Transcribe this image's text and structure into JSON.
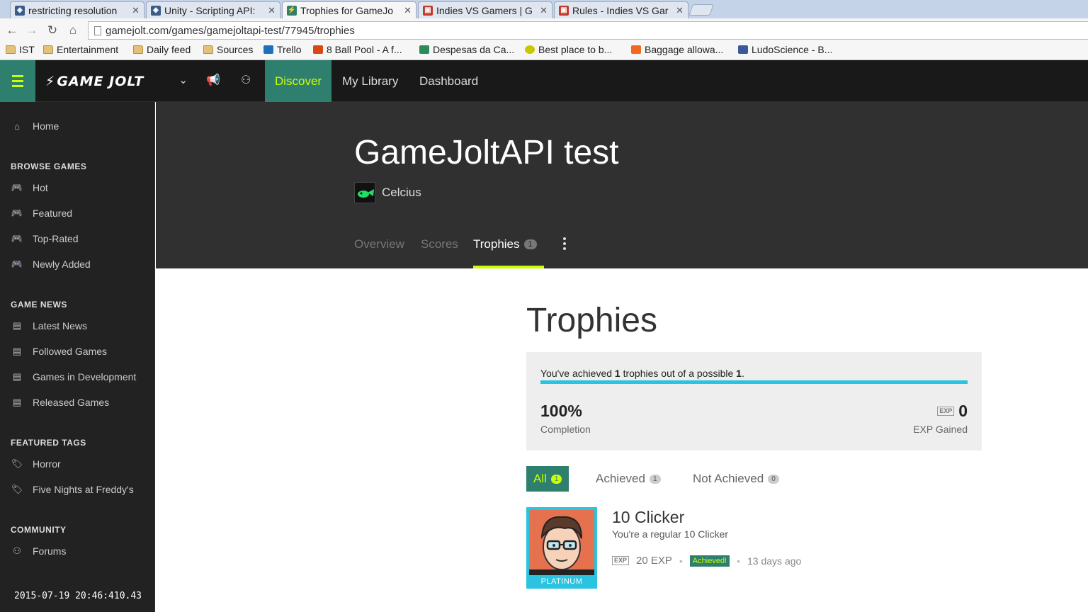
{
  "browser": {
    "tabs": [
      {
        "title": "restricting resolution",
        "icon_color": "#3b5b8a"
      },
      {
        "title": "Unity - Scripting API:",
        "icon_color": "#3b5b8a"
      },
      {
        "title": "Trophies for GameJo",
        "icon_color": "#2f7f6f"
      },
      {
        "title": "Indies VS Gamers | G",
        "icon_color": "#c0392b"
      },
      {
        "title": "Rules - Indies VS Gar",
        "icon_color": "#c0392b"
      }
    ],
    "url": "gamejolt.com/games/gamejoltapi-test/77945/trophies",
    "bookmarks": [
      {
        "label": "IST",
        "icon": "folder-icon"
      },
      {
        "label": "Entertainment",
        "icon": "folder-icon"
      },
      {
        "label": "Daily feed",
        "icon": "folder-icon"
      },
      {
        "label": "Sources",
        "icon": "folder-icon"
      },
      {
        "label": "Trello",
        "icon": "trello-icon"
      },
      {
        "label": "8 Ball Pool - A f...",
        "icon": "game-icon"
      },
      {
        "label": "Despesas da Ca...",
        "icon": "sheet-icon"
      },
      {
        "label": "Best place to b...",
        "icon": "smiley-icon"
      },
      {
        "label": "Baggage allowa...",
        "icon": "orange-icon"
      },
      {
        "label": "LudoScience - B...",
        "icon": "facebook-icon"
      }
    ]
  },
  "topnav": {
    "logo": "GAME JOLT",
    "discover": "Discover",
    "my_library": "My Library",
    "dashboard": "Dashboard"
  },
  "sidebar": {
    "home": "Home",
    "sections": [
      {
        "heading": "BROWSE GAMES",
        "items": [
          "Hot",
          "Featured",
          "Top-Rated",
          "Newly Added"
        ]
      },
      {
        "heading": "GAME NEWS",
        "items": [
          "Latest News",
          "Followed Games",
          "Games in Development",
          "Released Games"
        ]
      },
      {
        "heading": "FEATURED TAGS",
        "items": [
          "Horror",
          "Five Nights at Freddy's"
        ]
      },
      {
        "heading": "COMMUNITY",
        "items": [
          "Forums"
        ]
      }
    ],
    "timestamp": "2015-07-19 20:46:410.43"
  },
  "game": {
    "title": "GameJoltAPI test",
    "developer": "Celcius",
    "tabs": {
      "overview": "Overview",
      "scores": "Scores",
      "trophies": "Trophies",
      "trophies_count": "1"
    }
  },
  "trophies": {
    "heading": "Trophies",
    "summary": {
      "prefix": "You've achieved ",
      "achieved": "1",
      "middle": " trophies out of a possible ",
      "possible": "1",
      "suffix": ".",
      "progress": 1.0,
      "completion_value": "100%",
      "completion_label": "Completion",
      "exp_value": "0",
      "exp_label": "EXP Gained",
      "exp_icon_text": "EXP"
    },
    "filters": [
      {
        "label": "All",
        "count": "1"
      },
      {
        "label": "Achieved",
        "count": "1"
      },
      {
        "label": "Not Achieved",
        "count": "0"
      }
    ],
    "items": [
      {
        "title": "10 Clicker",
        "description": "You're a regular 10 Clicker",
        "exp": "20 EXP",
        "status": "Achieved!",
        "time": "13 days ago",
        "rank": "PLATINUM"
      }
    ]
  },
  "colors": {
    "accent": "#ccff00",
    "teal": "#2f7f6f",
    "progress": "#2bc4e0"
  }
}
